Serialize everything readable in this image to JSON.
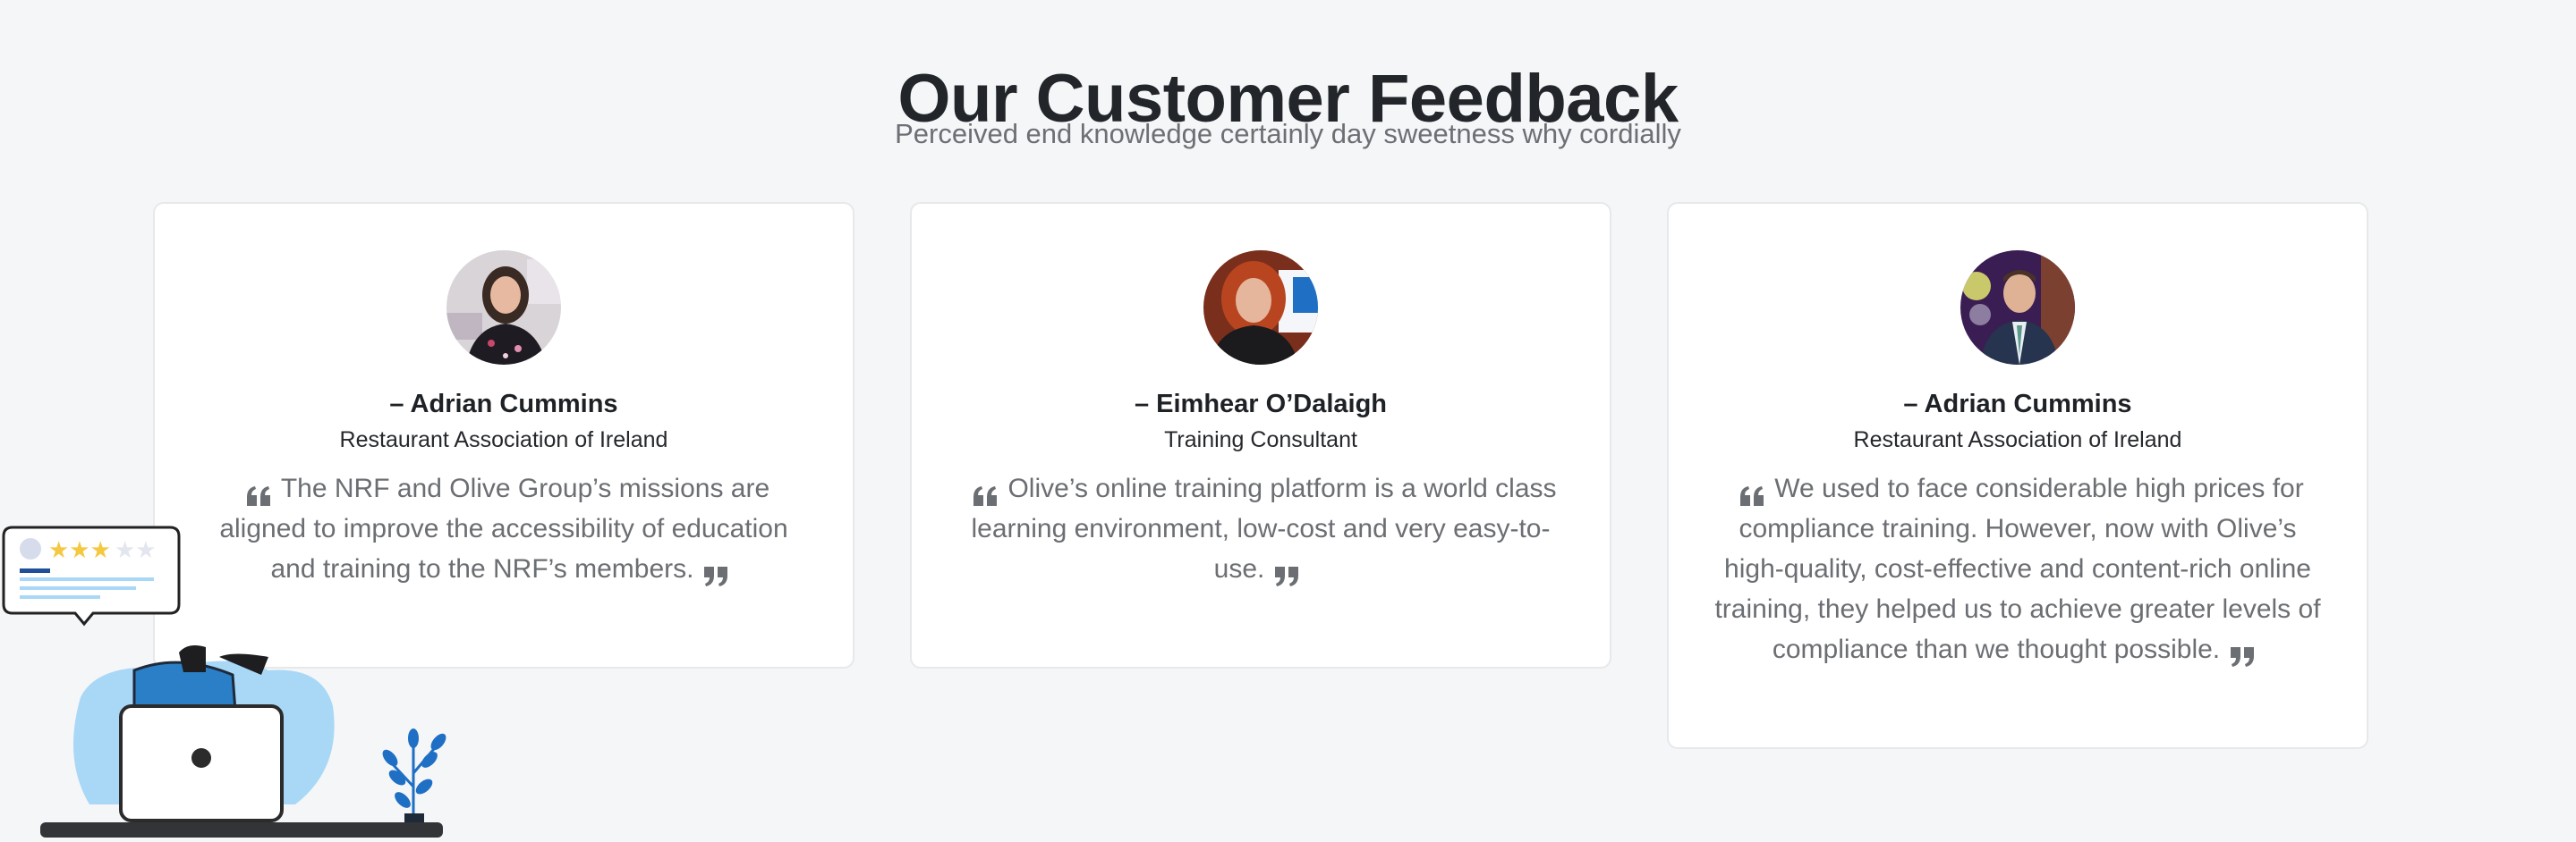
{
  "section": {
    "title": "Our Customer Feedback",
    "subtitle": "Perceived end knowledge certainly day sweetness why cordially"
  },
  "testimonials": [
    {
      "name": "– Adrian Cummins",
      "org": "Restaurant Association of Ireland",
      "quote": "The NRF and Olive Group’s missions are aligned to improve the accessibility of education and training to the NRF’s members.",
      "avatar_icon": "avatar-photo-woman-dark-hair"
    },
    {
      "name": "– Eimhear O’Dalaigh",
      "org": "Training Consultant",
      "quote": "Olive’s online training platform is a world class learning environment, low-cost and very easy-to-use.",
      "avatar_icon": "avatar-photo-woman-red-hair"
    },
    {
      "name": "– Adrian Cummins",
      "org": "Restaurant Association of Ireland",
      "quote": "We used to face considerable high prices for compliance training. However, now with Olive’s high-quality, cost-effective and content-rich online training, they helped us to achieve greater levels of compliance than we thought possible.",
      "avatar_icon": "avatar-photo-man-suit"
    }
  ],
  "colors": {
    "background": "#f5f6f8",
    "heading": "#222529",
    "body_text": "#6b6e72",
    "illustration_blue": "#2a7fc6",
    "illustration_light_blue": "#a9d8f7",
    "star_gold": "#f5c842"
  }
}
